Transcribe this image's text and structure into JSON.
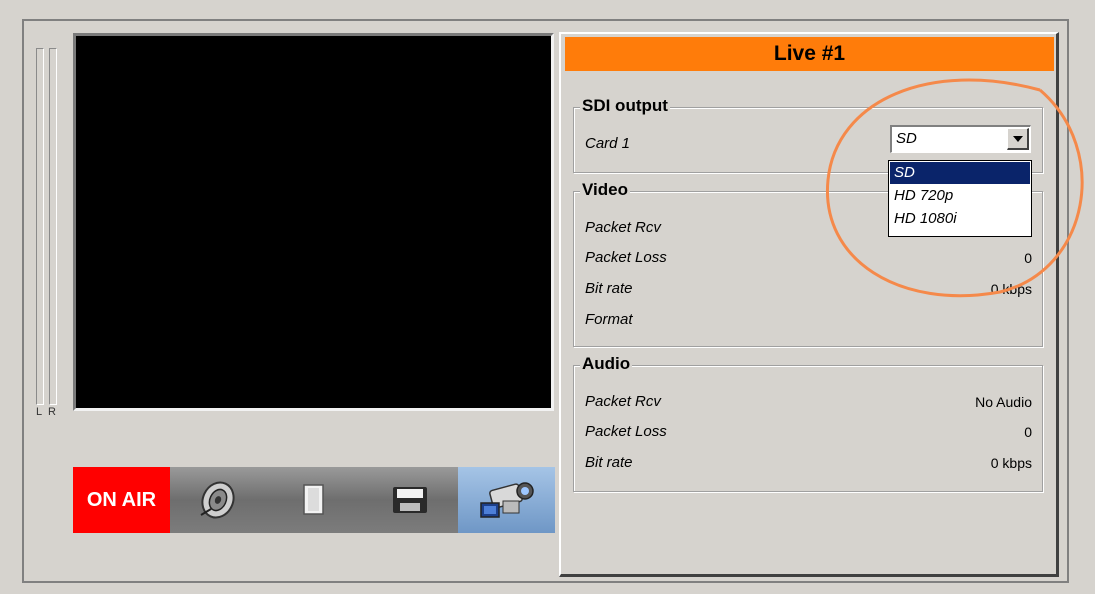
{
  "meter": {
    "left_label": "L",
    "right_label": "R"
  },
  "toolbar": {
    "on_air_label": "ON AIR",
    "icons": [
      "speaker-icon",
      "document-icon",
      "floppy-disk-icon",
      "video-camera-icon"
    ]
  },
  "panel": {
    "title": "Live #1",
    "sdi": {
      "title": "SDI output",
      "card_label": "Card 1",
      "selected": "SD",
      "options": [
        "SD",
        "HD 720p",
        "HD 1080i"
      ]
    },
    "video": {
      "title": "Video",
      "rows": [
        {
          "label": "Packet Rcv",
          "value": ""
        },
        {
          "label": "Packet Loss",
          "value": "0"
        },
        {
          "label": "Bit rate",
          "value": "0 kbps"
        },
        {
          "label": "Format",
          "value": ""
        }
      ]
    },
    "audio": {
      "title": "Audio",
      "rows": [
        {
          "label": "Packet Rcv",
          "value": "No Audio"
        },
        {
          "label": "Packet Loss",
          "value": "0"
        },
        {
          "label": "Bit rate",
          "value": "0 kbps"
        }
      ]
    }
  },
  "colors": {
    "title_bar": "#ff7c0a",
    "on_air": "#ff0000",
    "selection": "#0a246a",
    "highlight_circle": "#f5894a"
  }
}
